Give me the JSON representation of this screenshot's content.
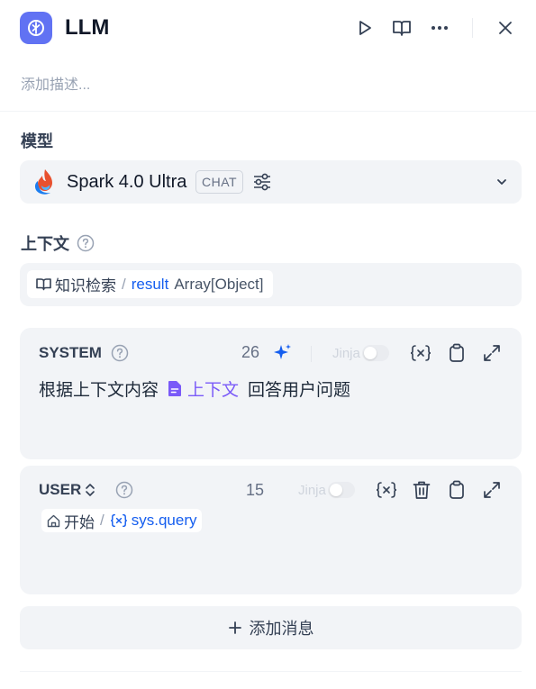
{
  "header": {
    "title": "LLM",
    "icons": [
      "llm-node-icon",
      "run-icon",
      "book-icon",
      "more-icon",
      "close-icon"
    ]
  },
  "description_placeholder": "添加描述...",
  "model_section": {
    "label": "模型",
    "model_name": "Spark 4.0 Ultra",
    "mode_badge": "CHAT"
  },
  "context_section": {
    "label": "上下文",
    "variable": {
      "node": "知识检索",
      "separator": "/",
      "name": "result",
      "type": "Array[Object]"
    }
  },
  "messages": [
    {
      "role": "SYSTEM",
      "token_count": "26",
      "jinja_label": "Jinja",
      "text_before": "根据上下文内容",
      "context_tag": "上下文",
      "text_after": "回答用户问题"
    },
    {
      "role": "USER",
      "token_count": "15",
      "jinja_label": "Jinja",
      "variable": {
        "node": "开始",
        "separator": "/",
        "name": "sys.query"
      }
    }
  ],
  "add_message_label": "添加消息",
  "colors": {
    "accent": "#6172f3",
    "link": "#155eef",
    "context_tag": "#7a5af8",
    "card_bg": "#f2f4f7"
  }
}
